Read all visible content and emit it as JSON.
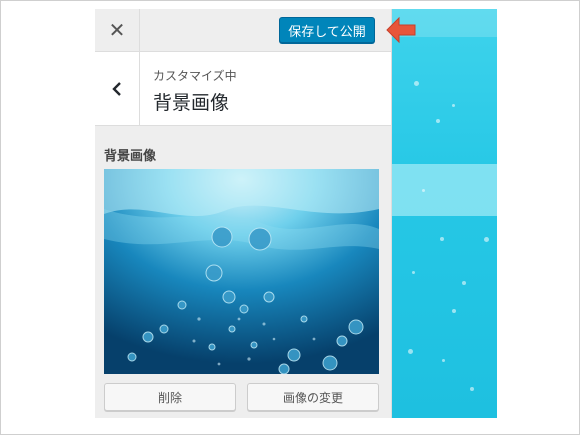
{
  "topbar": {
    "close_icon": "close-icon",
    "publish_label": "保存して公開"
  },
  "section": {
    "back_icon": "chevron-left-icon",
    "subtitle": "カスタマイズ中",
    "title": "背景画像"
  },
  "control": {
    "label": "背景画像",
    "remove_label": "削除",
    "change_label": "画像の変更"
  },
  "colors": {
    "publish_button": "#0085ba",
    "panel_bg": "#eeeeee",
    "preview_water": "#27c8e6",
    "annotation_arrow": "#e8553a"
  }
}
